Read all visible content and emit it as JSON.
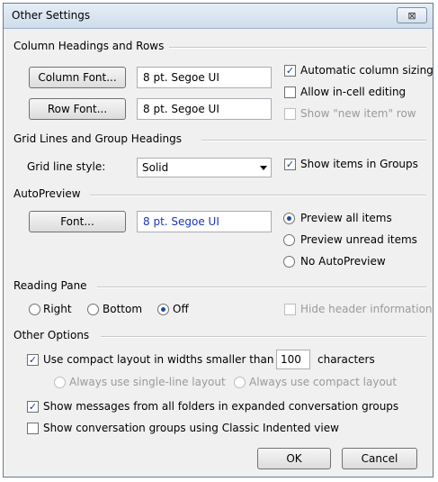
{
  "window": {
    "title": "Other Settings",
    "close_glyph": "⊠"
  },
  "column_headings": {
    "header": "Column Headings and Rows",
    "column_font_button": "Column Font...",
    "column_font_value": "8 pt. Segoe UI",
    "row_font_button": "Row Font...",
    "row_font_value": "8 pt. Segoe UI",
    "auto_col_sizing": "Automatic column sizing",
    "allow_in_cell": "Allow in-cell editing",
    "show_new_item": "Show \"new item\" row"
  },
  "grid_lines": {
    "header": "Grid Lines and Group Headings",
    "style_label": "Grid line style:",
    "style_value": "Solid",
    "show_in_groups": "Show items in Groups"
  },
  "autopreview": {
    "header": "AutoPreview",
    "font_button": "Font...",
    "font_value": "8 pt. Segoe UI",
    "preview_all": "Preview all items",
    "preview_unread": "Preview unread items",
    "no_autopreview": "No AutoPreview"
  },
  "reading_pane": {
    "header": "Reading Pane",
    "right": "Right",
    "bottom": "Bottom",
    "off": "Off",
    "hide_header": "Hide header information"
  },
  "other_options": {
    "header": "Other Options",
    "compact_layout": "Use compact layout in widths smaller than",
    "compact_width": "100",
    "characters": "characters",
    "single_line": "Always use single-line layout",
    "always_compact": "Always use compact layout",
    "show_messages_all": "Show messages from all folders in expanded conversation groups",
    "show_classic_indented": "Show conversation groups using Classic Indented view"
  },
  "footer": {
    "ok": "OK",
    "cancel": "Cancel"
  },
  "colors": {
    "font_value_blue": "#1a35b8"
  }
}
